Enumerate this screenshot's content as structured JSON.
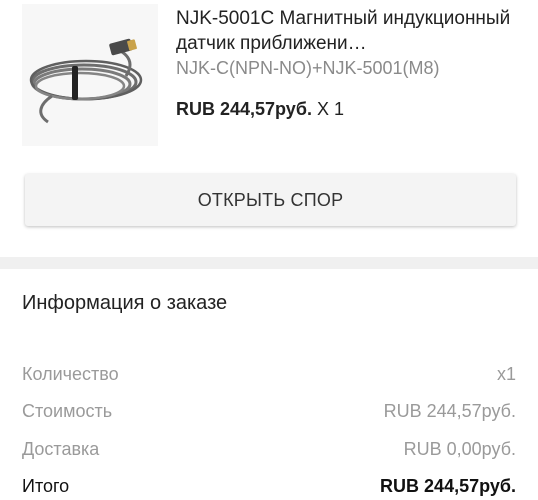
{
  "product": {
    "title": "NJK-5001C Магнитный индукционный датчик приближени…",
    "variant": "NJK-C(NPN-NO)+NJK-5001(M8)",
    "price": "RUB 244,57руб.",
    "quantity": "X 1",
    "image_icon": "proximity-sensor-cable-image"
  },
  "actions": {
    "open_dispute_label": "ОТКРЫТЬ СПОР"
  },
  "order_info": {
    "heading": "Информация о заказе",
    "rows": [
      {
        "label": "Количество",
        "value": "x1"
      },
      {
        "label": "Стоимость",
        "value": "RUB 244,57руб."
      },
      {
        "label": "Доставка",
        "value": "RUB 0,00руб."
      },
      {
        "label": "Итого",
        "value": "RUB 244,57руб."
      }
    ]
  },
  "colors": {
    "divider": "#f0f0f0",
    "muted_text": "#9a9a9a",
    "button_bg": "#f4f4f4"
  }
}
